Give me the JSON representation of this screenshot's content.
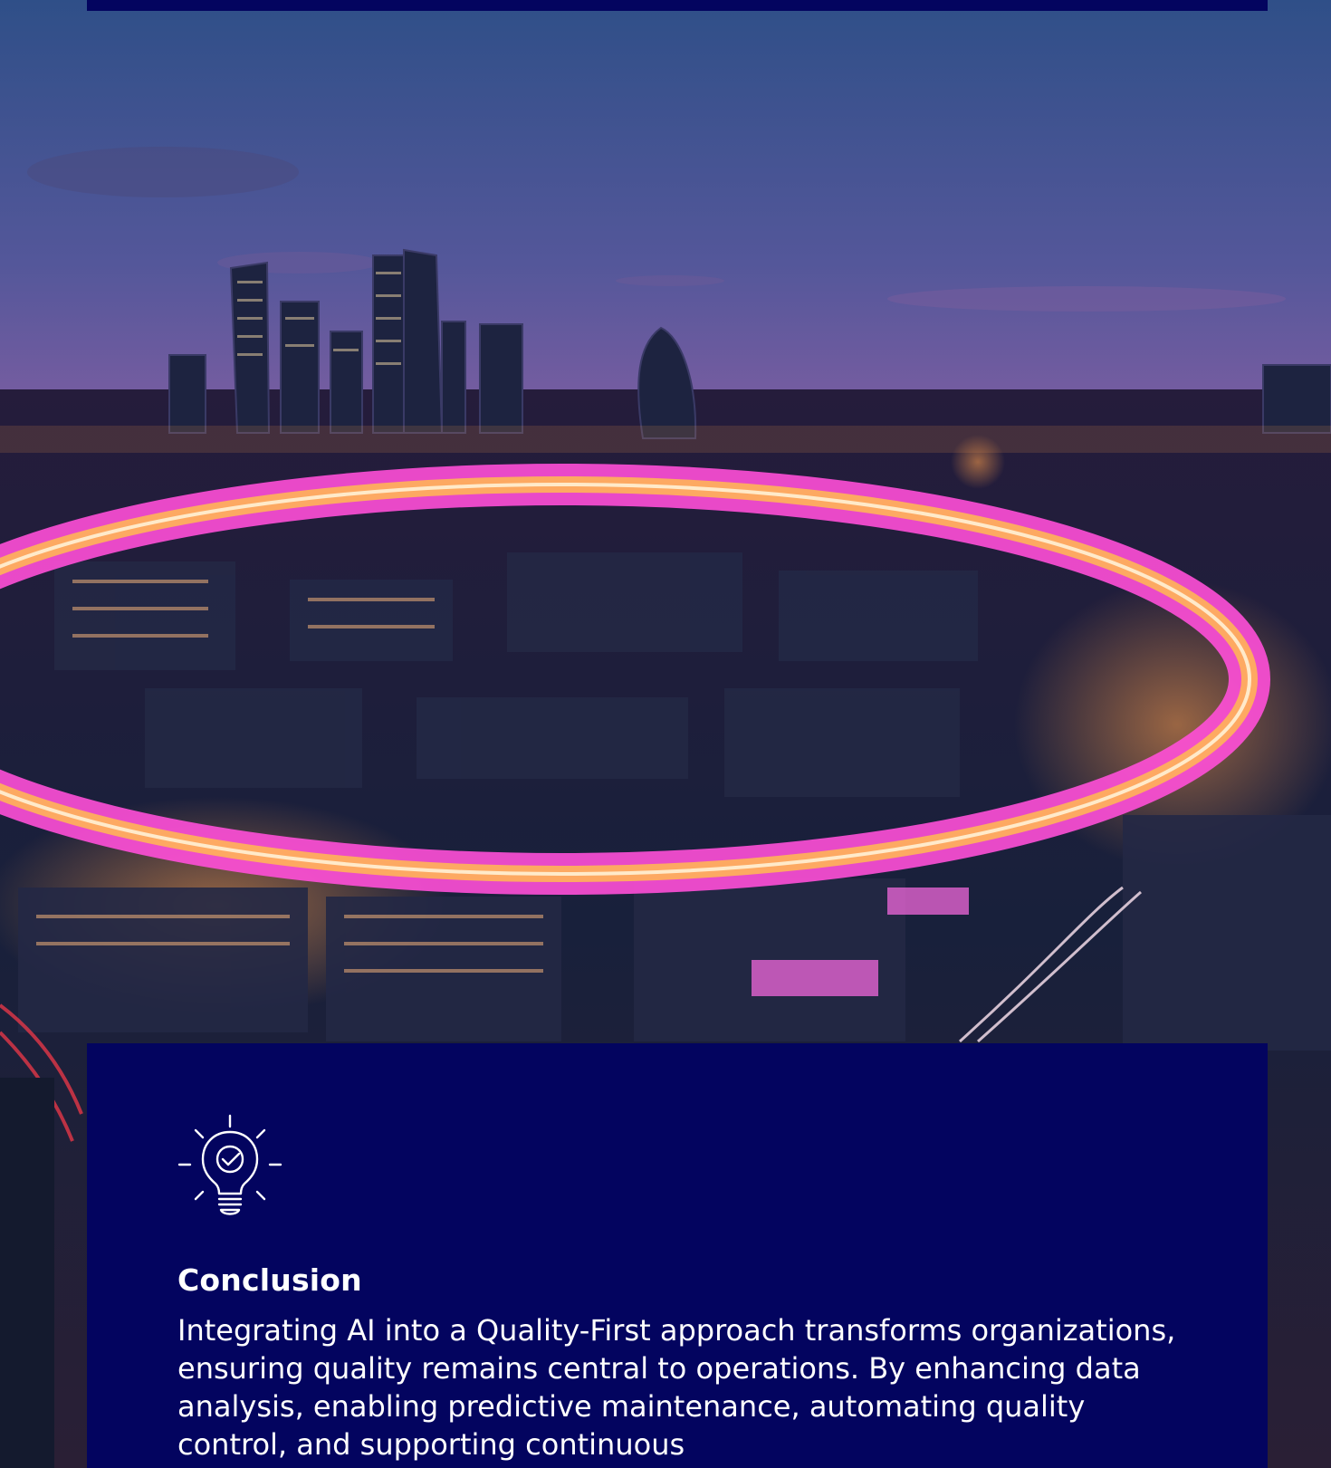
{
  "colors": {
    "navy": "#03045f",
    "ring_pink": "#ff4fd8",
    "ring_orange": "#ffb457"
  },
  "hero": {
    "image": "city-night-skyline-with-light-ring"
  },
  "conclusion": {
    "icon": "lightbulb-check-icon",
    "title": "Conclusion",
    "body": "Integrating AI into a Quality-First approach transforms organizations, ensuring quality remains central to operations. By enhancing data analysis, enabling predictive maintenance, automating quality control, and supporting continuous"
  }
}
